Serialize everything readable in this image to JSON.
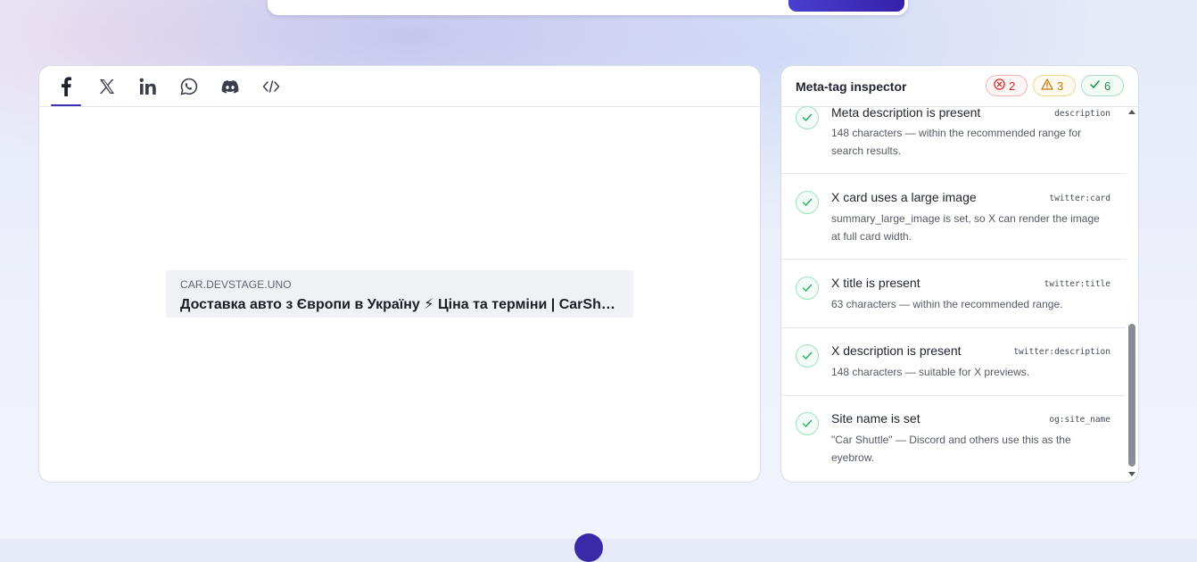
{
  "preview": {
    "tabs": [
      {
        "name": "facebook",
        "icon": "facebook-icon",
        "active": true
      },
      {
        "name": "x",
        "icon": "x-icon",
        "active": false
      },
      {
        "name": "linkedin",
        "icon": "linkedin-icon",
        "active": false
      },
      {
        "name": "whatsapp",
        "icon": "whatsapp-icon",
        "active": false
      },
      {
        "name": "discord",
        "icon": "discord-icon",
        "active": false
      },
      {
        "name": "embed",
        "icon": "code-icon",
        "active": false
      }
    ],
    "card": {
      "domain": "CAR.DEVSTAGE.UNO",
      "title": "Доставка авто з Європи в Україну ⚡ Ціна та терміни | CarShuttle"
    }
  },
  "inspector": {
    "title": "Meta-tag inspector",
    "counts": {
      "errors": "2",
      "warnings": "3",
      "passed": "6"
    },
    "items": [
      {
        "title": "Meta description is present",
        "tag": "description",
        "desc": "148 characters — within the recommended range for search results.",
        "status": "pass"
      },
      {
        "title": "X card uses a large image",
        "tag": "twitter:card",
        "desc": "summary_large_image is set, so X can render the image at full card width.",
        "status": "pass"
      },
      {
        "title": "X title is present",
        "tag": "twitter:title",
        "desc": "63 characters — within the recommended range.",
        "status": "pass"
      },
      {
        "title": "X description is present",
        "tag": "twitter:description",
        "desc": "148 characters — suitable for X previews.",
        "status": "pass"
      },
      {
        "title": "Site name is set",
        "tag": "og:site_name",
        "desc": "\"Car Shuttle\" — Discord and others use this as the eyebrow.",
        "status": "pass"
      }
    ],
    "scroll_fraction": 0.85
  },
  "colors": {
    "accent": "#3b2fb3",
    "error": "#d12b2b",
    "warning": "#c47a08",
    "success": "#198a4b"
  }
}
